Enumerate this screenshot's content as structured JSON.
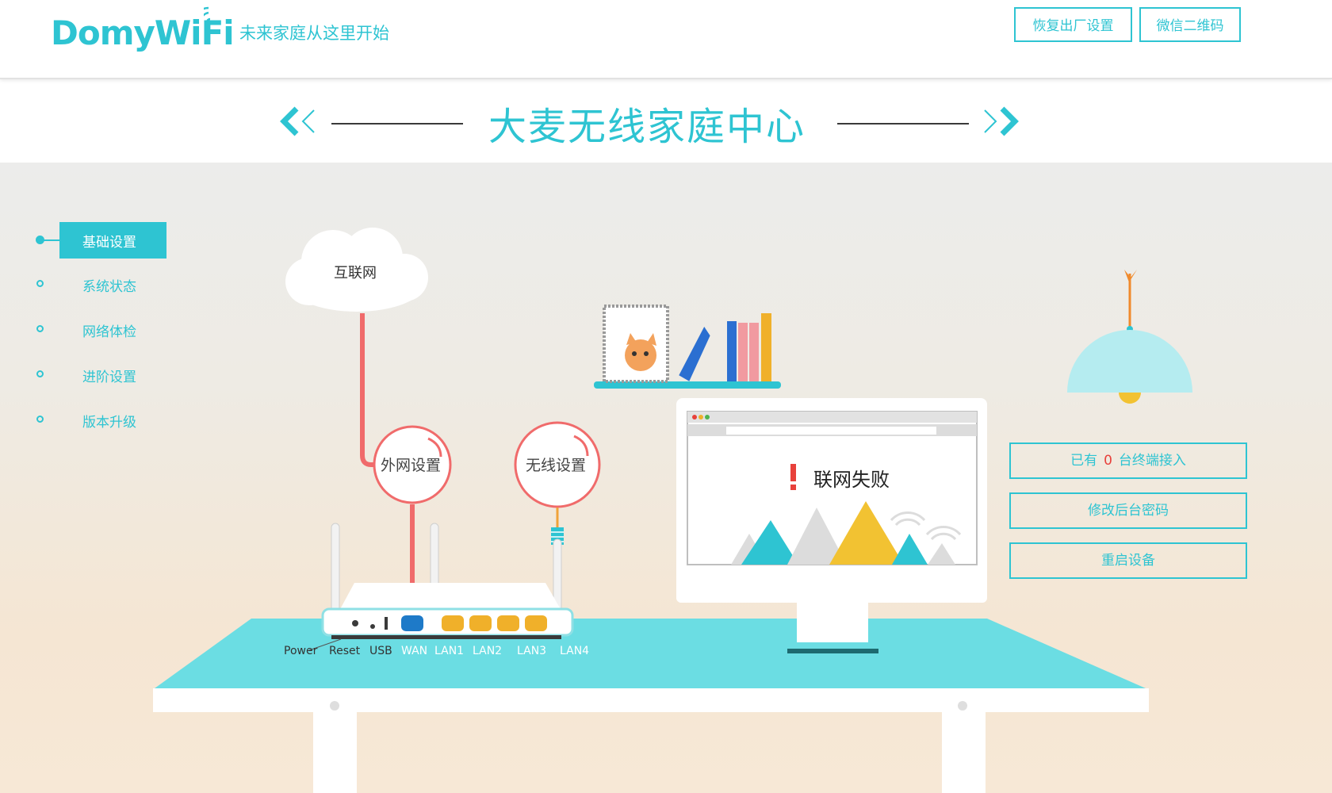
{
  "header": {
    "logo_text": "DomyWiFi",
    "slogan": "未来家庭从这里开始",
    "buttons": [
      {
        "label": "恢复出厂设置"
      },
      {
        "label": "微信二维码"
      }
    ]
  },
  "title": {
    "text": "大麦无线家庭中心"
  },
  "nav": {
    "items": [
      {
        "label": "基础设置",
        "active": true
      },
      {
        "label": "系统状态",
        "active": false
      },
      {
        "label": "网络体检",
        "active": false
      },
      {
        "label": "进阶设置",
        "active": false
      },
      {
        "label": "版本升级",
        "active": false
      }
    ]
  },
  "scene": {
    "cloud_label": "互联网",
    "wan_circle_label": "外网设置",
    "wireless_circle_label": "无线设置",
    "monitor_status": "联网失败",
    "ports": [
      "Power",
      "Reset",
      "USB",
      "WAN",
      "LAN1",
      "LAN2",
      "LAN3",
      "LAN4"
    ]
  },
  "right_panel": {
    "terminals_prefix": "已有",
    "terminals_count": "0",
    "terminals_suffix": "台终端接入",
    "change_password": "修改后台密码",
    "reboot": "重启设备"
  },
  "colors": {
    "accent": "#2ec4d2",
    "alert": "#e8413b",
    "cable_red": "#f06b6b",
    "desk": "#6bdde3"
  }
}
